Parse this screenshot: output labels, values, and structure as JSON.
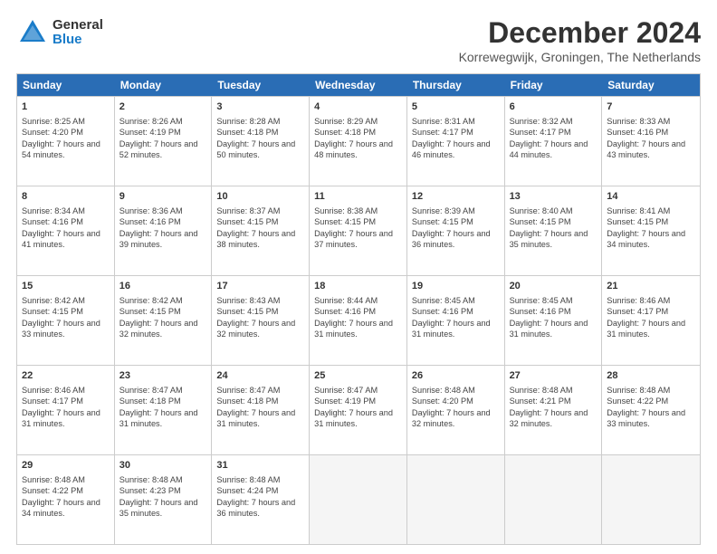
{
  "logo": {
    "general": "General",
    "blue": "Blue"
  },
  "title": "December 2024",
  "subtitle": "Korrewegwijk, Groningen, The Netherlands",
  "headers": [
    "Sunday",
    "Monday",
    "Tuesday",
    "Wednesday",
    "Thursday",
    "Friday",
    "Saturday"
  ],
  "weeks": [
    [
      {
        "day": "1",
        "sunrise": "Sunrise: 8:25 AM",
        "sunset": "Sunset: 4:20 PM",
        "daylight": "Daylight: 7 hours and 54 minutes."
      },
      {
        "day": "2",
        "sunrise": "Sunrise: 8:26 AM",
        "sunset": "Sunset: 4:19 PM",
        "daylight": "Daylight: 7 hours and 52 minutes."
      },
      {
        "day": "3",
        "sunrise": "Sunrise: 8:28 AM",
        "sunset": "Sunset: 4:18 PM",
        "daylight": "Daylight: 7 hours and 50 minutes."
      },
      {
        "day": "4",
        "sunrise": "Sunrise: 8:29 AM",
        "sunset": "Sunset: 4:18 PM",
        "daylight": "Daylight: 7 hours and 48 minutes."
      },
      {
        "day": "5",
        "sunrise": "Sunrise: 8:31 AM",
        "sunset": "Sunset: 4:17 PM",
        "daylight": "Daylight: 7 hours and 46 minutes."
      },
      {
        "day": "6",
        "sunrise": "Sunrise: 8:32 AM",
        "sunset": "Sunset: 4:17 PM",
        "daylight": "Daylight: 7 hours and 44 minutes."
      },
      {
        "day": "7",
        "sunrise": "Sunrise: 8:33 AM",
        "sunset": "Sunset: 4:16 PM",
        "daylight": "Daylight: 7 hours and 43 minutes."
      }
    ],
    [
      {
        "day": "8",
        "sunrise": "Sunrise: 8:34 AM",
        "sunset": "Sunset: 4:16 PM",
        "daylight": "Daylight: 7 hours and 41 minutes."
      },
      {
        "day": "9",
        "sunrise": "Sunrise: 8:36 AM",
        "sunset": "Sunset: 4:16 PM",
        "daylight": "Daylight: 7 hours and 39 minutes."
      },
      {
        "day": "10",
        "sunrise": "Sunrise: 8:37 AM",
        "sunset": "Sunset: 4:15 PM",
        "daylight": "Daylight: 7 hours and 38 minutes."
      },
      {
        "day": "11",
        "sunrise": "Sunrise: 8:38 AM",
        "sunset": "Sunset: 4:15 PM",
        "daylight": "Daylight: 7 hours and 37 minutes."
      },
      {
        "day": "12",
        "sunrise": "Sunrise: 8:39 AM",
        "sunset": "Sunset: 4:15 PM",
        "daylight": "Daylight: 7 hours and 36 minutes."
      },
      {
        "day": "13",
        "sunrise": "Sunrise: 8:40 AM",
        "sunset": "Sunset: 4:15 PM",
        "daylight": "Daylight: 7 hours and 35 minutes."
      },
      {
        "day": "14",
        "sunrise": "Sunrise: 8:41 AM",
        "sunset": "Sunset: 4:15 PM",
        "daylight": "Daylight: 7 hours and 34 minutes."
      }
    ],
    [
      {
        "day": "15",
        "sunrise": "Sunrise: 8:42 AM",
        "sunset": "Sunset: 4:15 PM",
        "daylight": "Daylight: 7 hours and 33 minutes."
      },
      {
        "day": "16",
        "sunrise": "Sunrise: 8:42 AM",
        "sunset": "Sunset: 4:15 PM",
        "daylight": "Daylight: 7 hours and 32 minutes."
      },
      {
        "day": "17",
        "sunrise": "Sunrise: 8:43 AM",
        "sunset": "Sunset: 4:15 PM",
        "daylight": "Daylight: 7 hours and 32 minutes."
      },
      {
        "day": "18",
        "sunrise": "Sunrise: 8:44 AM",
        "sunset": "Sunset: 4:16 PM",
        "daylight": "Daylight: 7 hours and 31 minutes."
      },
      {
        "day": "19",
        "sunrise": "Sunrise: 8:45 AM",
        "sunset": "Sunset: 4:16 PM",
        "daylight": "Daylight: 7 hours and 31 minutes."
      },
      {
        "day": "20",
        "sunrise": "Sunrise: 8:45 AM",
        "sunset": "Sunset: 4:16 PM",
        "daylight": "Daylight: 7 hours and 31 minutes."
      },
      {
        "day": "21",
        "sunrise": "Sunrise: 8:46 AM",
        "sunset": "Sunset: 4:17 PM",
        "daylight": "Daylight: 7 hours and 31 minutes."
      }
    ],
    [
      {
        "day": "22",
        "sunrise": "Sunrise: 8:46 AM",
        "sunset": "Sunset: 4:17 PM",
        "daylight": "Daylight: 7 hours and 31 minutes."
      },
      {
        "day": "23",
        "sunrise": "Sunrise: 8:47 AM",
        "sunset": "Sunset: 4:18 PM",
        "daylight": "Daylight: 7 hours and 31 minutes."
      },
      {
        "day": "24",
        "sunrise": "Sunrise: 8:47 AM",
        "sunset": "Sunset: 4:18 PM",
        "daylight": "Daylight: 7 hours and 31 minutes."
      },
      {
        "day": "25",
        "sunrise": "Sunrise: 8:47 AM",
        "sunset": "Sunset: 4:19 PM",
        "daylight": "Daylight: 7 hours and 31 minutes."
      },
      {
        "day": "26",
        "sunrise": "Sunrise: 8:48 AM",
        "sunset": "Sunset: 4:20 PM",
        "daylight": "Daylight: 7 hours and 32 minutes."
      },
      {
        "day": "27",
        "sunrise": "Sunrise: 8:48 AM",
        "sunset": "Sunset: 4:21 PM",
        "daylight": "Daylight: 7 hours and 32 minutes."
      },
      {
        "day": "28",
        "sunrise": "Sunrise: 8:48 AM",
        "sunset": "Sunset: 4:22 PM",
        "daylight": "Daylight: 7 hours and 33 minutes."
      }
    ],
    [
      {
        "day": "29",
        "sunrise": "Sunrise: 8:48 AM",
        "sunset": "Sunset: 4:22 PM",
        "daylight": "Daylight: 7 hours and 34 minutes."
      },
      {
        "day": "30",
        "sunrise": "Sunrise: 8:48 AM",
        "sunset": "Sunset: 4:23 PM",
        "daylight": "Daylight: 7 hours and 35 minutes."
      },
      {
        "day": "31",
        "sunrise": "Sunrise: 8:48 AM",
        "sunset": "Sunset: 4:24 PM",
        "daylight": "Daylight: 7 hours and 36 minutes."
      },
      null,
      null,
      null,
      null
    ]
  ]
}
